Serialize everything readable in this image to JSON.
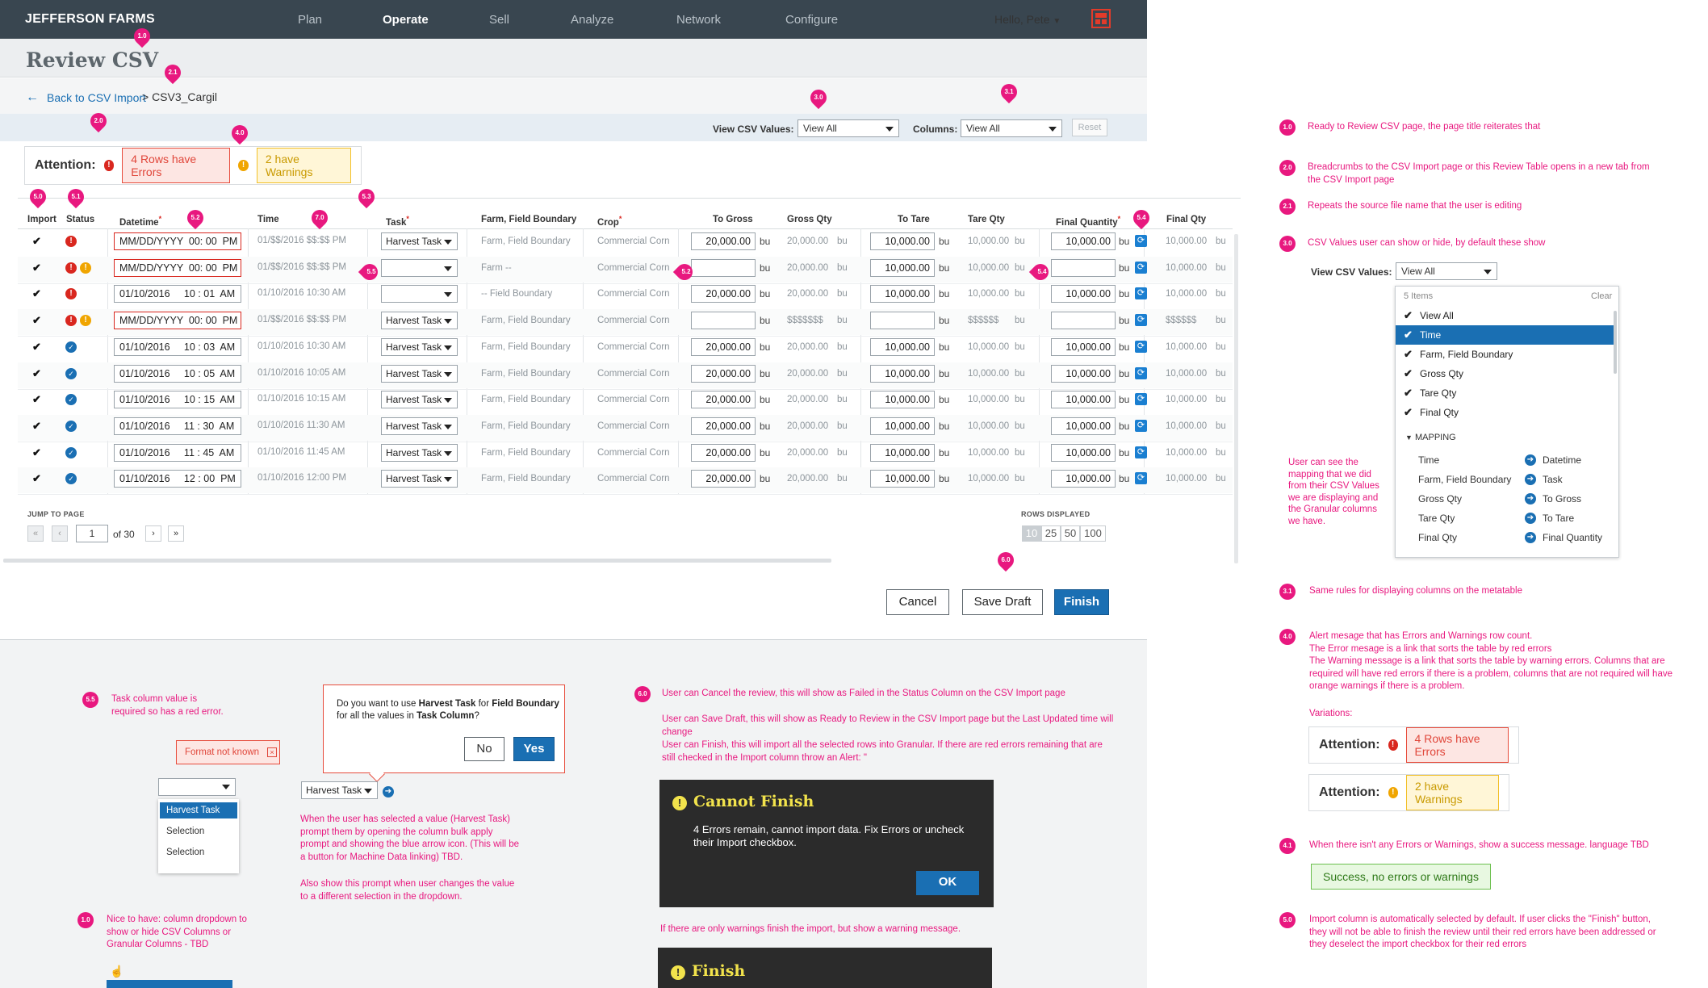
{
  "app": {
    "brand": "JEFFERSON FARMS",
    "nav": [
      "Plan",
      "Operate",
      "Sell",
      "Analyze",
      "Network",
      "Configure"
    ],
    "active_nav": "Operate",
    "user": "Hello, Pete"
  },
  "page": {
    "title": "Review CSV",
    "back": "Back to CSV Import",
    "crumb": "> CSV3_Cargil"
  },
  "filters": {
    "view_label": "View CSV Values:",
    "view_value": "View All",
    "columns_label": "Columns:",
    "columns_value": "View All",
    "reset": "Reset"
  },
  "attention": {
    "label": "Attention:",
    "errors": "4 Rows have Errors",
    "warnings": "2 have Warnings"
  },
  "table": {
    "headers": [
      "Import",
      "Status",
      "Datetime",
      "Time",
      "Task",
      "Farm, Field Boundary",
      "Crop",
      "To Gross",
      "Gross Qty",
      "To Tare",
      "Tare Qty",
      "Final Quantity",
      "Final Qty"
    ],
    "unit": "bu",
    "rows": [
      {
        "status": "err",
        "datetime": "MM/DD/YYYY  00: 00  PM",
        "dt_err": true,
        "time": "01/$$/2016 $$:$$ PM",
        "task": "Harvest Task",
        "farm": "Farm, Field Boundary",
        "crop": "Commercial Corn",
        "to_gross": "20,000.00",
        "gross": "20,000.00",
        "to_tare": "10,000.00",
        "tare": "10,000.00",
        "final": "10,000.00",
        "final_qty": "10,000.00"
      },
      {
        "status": "errwarn",
        "datetime": "MM/DD/YYYY  00: 00  PM",
        "dt_err": true,
        "time": "01/$$/2016 $$:$$ PM",
        "task": "",
        "farm": "Farm --",
        "crop": "Commercial Corn",
        "to_gross": "",
        "gross": "20,000.00",
        "to_tare": "10,000.00",
        "tare": "10,000.00",
        "final": "",
        "final_qty": "10,000.00"
      },
      {
        "status": "err",
        "datetime": "01/10/2016     10 : 01  AM",
        "dt_err": false,
        "time": "01/10/2016 10:30 AM",
        "task": "",
        "farm": "-- Field Boundary",
        "crop": "Commercial Corn",
        "to_gross": "20,000.00",
        "gross": "20,000.00",
        "to_tare": "10,000.00",
        "tare": "10,000.00",
        "final": "10,000.00",
        "final_qty": "10,000.00"
      },
      {
        "status": "errwarn",
        "datetime": "MM/DD/YYYY  00: 00  PM",
        "dt_err": true,
        "time": "01/$$/2016 $$:$$ PM",
        "task": "Harvest Task",
        "farm": "Farm, Field Boundary",
        "crop": "Commercial Corn",
        "to_gross": "",
        "gross": "$$$$$$$",
        "to_tare": "",
        "tare": "$$$$$$",
        "final": "",
        "final_qty": "$$$$$$"
      },
      {
        "status": "ok",
        "datetime": "01/10/2016     10 : 03  AM",
        "dt_err": false,
        "time": "01/10/2016 10:30 AM",
        "task": "Harvest Task",
        "farm": "Farm, Field Boundary",
        "crop": "Commercial Corn",
        "to_gross": "20,000.00",
        "gross": "20,000.00",
        "to_tare": "10,000.00",
        "tare": "10,000.00",
        "final": "10,000.00",
        "final_qty": "10,000.00"
      },
      {
        "status": "ok",
        "datetime": "01/10/2016     10 : 05  AM",
        "dt_err": false,
        "time": "01/10/2016 10:05 AM",
        "task": "Harvest Task",
        "farm": "Farm, Field Boundary",
        "crop": "Commercial Corn",
        "to_gross": "20,000.00",
        "gross": "20,000.00",
        "to_tare": "10,000.00",
        "tare": "10,000.00",
        "final": "10,000.00",
        "final_qty": "10,000.00"
      },
      {
        "status": "ok",
        "datetime": "01/10/2016     10 : 15  AM",
        "dt_err": false,
        "time": "01/10/2016 10:15 AM",
        "task": "Harvest Task",
        "farm": "Farm, Field Boundary",
        "crop": "Commercial Corn",
        "to_gross": "20,000.00",
        "gross": "20,000.00",
        "to_tare": "10,000.00",
        "tare": "10,000.00",
        "final": "10,000.00",
        "final_qty": "10,000.00"
      },
      {
        "status": "ok",
        "datetime": "01/10/2016     11 : 30  AM",
        "dt_err": false,
        "time": "01/10/2016 11:30 AM",
        "task": "Harvest Task",
        "farm": "Farm, Field Boundary",
        "crop": "Commercial Corn",
        "to_gross": "20,000.00",
        "gross": "20,000.00",
        "to_tare": "10,000.00",
        "tare": "10,000.00",
        "final": "10,000.00",
        "final_qty": "10,000.00"
      },
      {
        "status": "ok",
        "datetime": "01/10/2016     11 : 45  AM",
        "dt_err": false,
        "time": "01/10/2016 11:45 AM",
        "task": "Harvest Task",
        "farm": "Farm, Field Boundary",
        "crop": "Commercial Corn",
        "to_gross": "20,000.00",
        "gross": "20,000.00",
        "to_tare": "10,000.00",
        "tare": "10,000.00",
        "final": "10,000.00",
        "final_qty": "10,000.00"
      },
      {
        "status": "ok",
        "datetime": "01/10/2016     12 : 00  PM",
        "dt_err": false,
        "time": "01/10/2016 12:00 PM",
        "task": "Harvest Task",
        "farm": "Farm, Field Boundary",
        "crop": "Commercial Corn",
        "to_gross": "20,000.00",
        "gross": "20,000.00",
        "to_tare": "10,000.00",
        "tare": "10,000.00",
        "final": "10,000.00",
        "final_qty": "10,000.00"
      }
    ]
  },
  "pager": {
    "jump_label": "JUMP TO PAGE",
    "page": "1",
    "of": "of 30",
    "rows_label": "ROWS DISPLAYED",
    "rows_options": [
      "10",
      "25",
      "50",
      "100"
    ],
    "rows_selected": "10"
  },
  "actions": {
    "cancel": "Cancel",
    "save": "Save Draft",
    "finish": "Finish"
  },
  "annotations": {
    "n10": "Ready to Review CSV page, the page title reiterates that",
    "n20": "Breadcrumbs to the CSV Import page or this Review Table opens in a new tab from the CSV Import page",
    "n21": "Repeats the source file name that the user is editing",
    "n30": "CSV Values user can show or hide, by default these show",
    "n31": "Same rules for displaying columns on the metatable",
    "n40": "Alert mesage that has Errors and Warnings row count.\nThe Error mesage is a link that sorts the table by red errors\nThe Warning message is a link that sorts the table by warning errors. Columns that are required will have red errors if there is a problem, columns that are not required will have orange warnings if there is a problem.",
    "variations": "Variations:",
    "n41": "When there isn't any Errors or Warnings, show a success message. language TBD",
    "success": "Success, no errors or warnings",
    "n50": "Import column is automatically selected by default. If user clicks the \"Finish\" button, they will not be able to finish the review until their red errors have been addressed or they deselect the import checkbox for their red errors",
    "mapping_note": "User can see the mapping that we did from their CSV Values we are displaying and the Granular columns we have.",
    "n55": "Task column value is required so has a red error.",
    "format_error": "Format not known",
    "bulk_q_pre": "Do you want to use ",
    "bulk_q_task": "Harvest Task",
    "bulk_q_mid": " for ",
    "bulk_q_field": "Field Boundary",
    "bulk_q_mid2": " for all the values in ",
    "bulk_q_col": "Task Column",
    "bulk_q_end": "?",
    "bulk_no": "No",
    "bulk_yes": "Yes",
    "bulk_note1": "When the user has selected a value (Harvest Task) prompt them by opening the column bulk apply prompt and showing the blue arrow icon. (This will be a button for Machine Data linking) TBD.",
    "bulk_note2": "Also show this prompt when user changes the value to a different selection in the dropdown.",
    "task_opts": [
      "Harvest Task",
      "Selection",
      "Selection"
    ],
    "n10b": "Nice to have: column dropdown to show or hide CSV Columns or Granular Columns - TBD",
    "n60a": "User can Cancel the review, this will show as Failed in the Status Column on the CSV Import page",
    "n60b": "User can Save Draft, this will show as Ready to Review in the CSV Import page but the Last Updated time will change",
    "n60c": "User can Finish, this will import all the selected rows into Granular. If there are red errors remaining that are still checked in the Import column throw an Alert: \"",
    "cannot_title": "Cannot Finish",
    "cannot_body": "4 Errors remain, cannot import data. Fix Errors or uncheck their Import checkbox.",
    "ok": "OK",
    "warn_only": "If there are only warnings finish the import, but show a warning message.",
    "finish_title": "Finish"
  },
  "dropdown": {
    "count": "5 Items",
    "clear": "Clear",
    "items": [
      "View All",
      "Time",
      "Farm, Field Boundary",
      "Gross Qty",
      "Tare Qty",
      "Final Qty"
    ],
    "mapping_label": "MAPPING",
    "mapping": [
      [
        "Time",
        "Datetime"
      ],
      [
        "Farm, Field Boundary",
        "Task"
      ],
      [
        "Gross Qty",
        "To Gross"
      ],
      [
        "Tare Qty",
        "To Tare"
      ],
      [
        "Final Qty",
        "Final Quantity"
      ]
    ]
  },
  "pins": {
    "p10": "1.0",
    "p21": "2.1",
    "p20": "2.0",
    "p30": "3.0",
    "p31": "3.1",
    "p40": "4.0",
    "p41": "4.1",
    "p50": "5.0",
    "p51": "5.1",
    "p52": "5.2",
    "p70": "7.0",
    "p53": "5.3",
    "p54": "5.4",
    "p55": "5.5",
    "p60": "6.0"
  },
  "colors": {
    "nav": "#394650",
    "accent": "#1a6fb3",
    "error": "#d9271f",
    "warning": "#f0a500",
    "annotation": "#e8187f"
  }
}
